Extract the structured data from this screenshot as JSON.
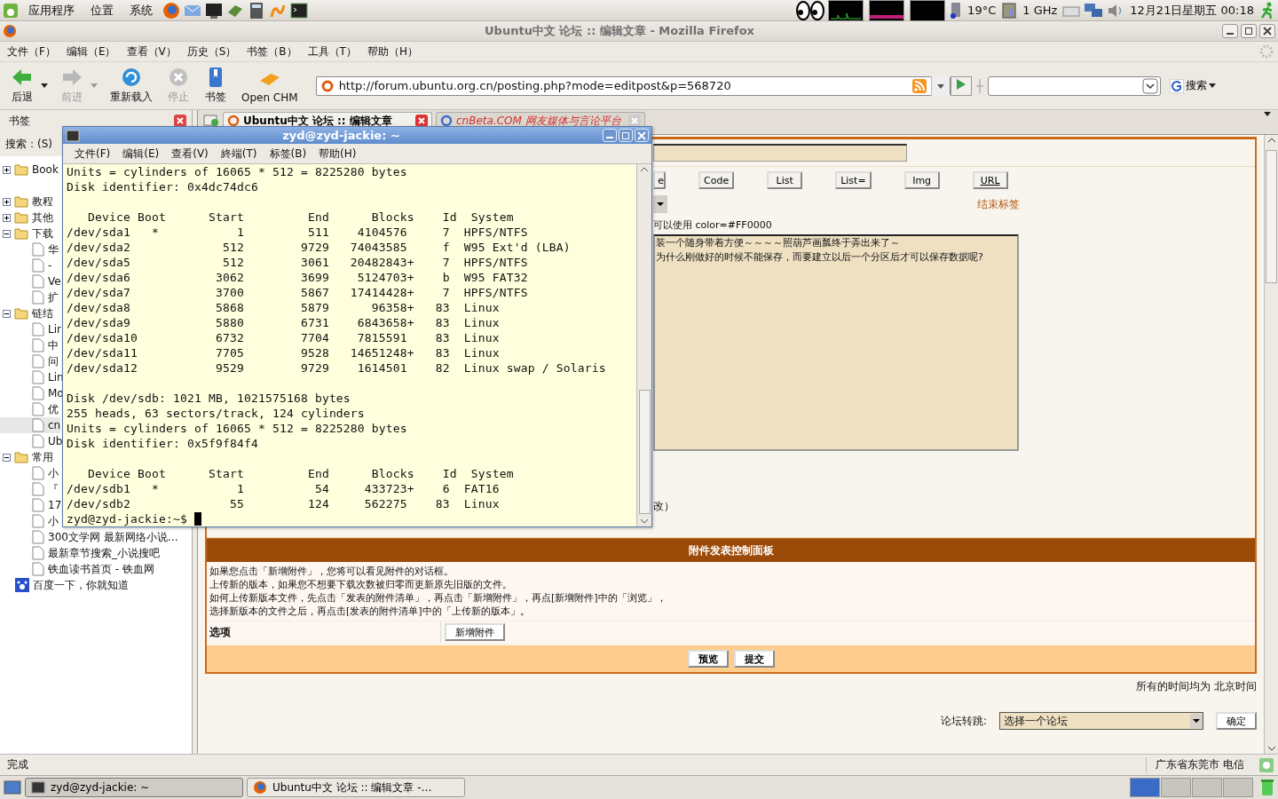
{
  "top_panel": {
    "menus": [
      "应用程序",
      "位置",
      "系统"
    ],
    "temperature": "19°C",
    "cpu": "1 GHz",
    "clock": "12月21日星期五 00:18"
  },
  "window": {
    "title": "Ubuntu中文 论坛 :: 编辑文章 - Mozilla Firefox"
  },
  "menu_bar": [
    "文件（F）",
    "编辑（E）",
    "查看（V）",
    "历史（S）",
    "书签（B）",
    "工具（T）",
    "帮助（H）"
  ],
  "toolbar": {
    "buttons": [
      {
        "label": "后退",
        "kind": "back",
        "disabled": false,
        "dropdown": true
      },
      {
        "label": "前进",
        "kind": "forward",
        "disabled": true,
        "dropdown": true
      },
      {
        "label": "重新载入",
        "kind": "reload",
        "disabled": false,
        "dropdown": false
      },
      {
        "label": "停止",
        "kind": "stop",
        "disabled": true,
        "dropdown": false
      },
      {
        "label": "书签",
        "kind": "bookmarks",
        "disabled": false,
        "dropdown": false
      },
      {
        "label": "Open CHM",
        "kind": "chm",
        "disabled": false,
        "dropdown": false
      }
    ],
    "url": "http://forum.ubuntu.org.cn/posting.php?mode=editpost&p=568720",
    "search_button": "搜索"
  },
  "sidebar": {
    "title": "书签",
    "search_label": "搜索：(S)",
    "tree": [
      {
        "label": "Book",
        "kind": "folder",
        "expanded": false
      },
      {
        "label": "教程",
        "kind": "folder",
        "expanded": false
      },
      {
        "label": "其他",
        "kind": "folder",
        "expanded": false
      },
      {
        "label": "下载",
        "kind": "folder",
        "expanded": true,
        "children": [
          {
            "label": "华",
            "selected": false
          },
          {
            "label": "-",
            "selected": false
          },
          {
            "label": "Ve",
            "selected": false
          },
          {
            "label": "扩",
            "selected": false
          }
        ]
      },
      {
        "label": "链结",
        "kind": "folder",
        "expanded": true,
        "children": [
          {
            "label": "Lir",
            "selected": false
          },
          {
            "label": "中",
            "selected": false
          },
          {
            "label": "问",
            "selected": false
          },
          {
            "label": "Lin",
            "selected": false
          },
          {
            "label": "Mo",
            "selected": false
          },
          {
            "label": "优",
            "selected": false
          },
          {
            "label": "cn",
            "selected": true
          },
          {
            "label": "Ub",
            "selected": false
          }
        ]
      },
      {
        "label": "常用",
        "kind": "folder",
        "expanded": true,
        "children": [
          {
            "label": "小",
            "selected": false
          },
          {
            "label": "『",
            "selected": false
          },
          {
            "label": "17",
            "selected": false
          },
          {
            "label": "小",
            "selected": false
          },
          {
            "label": "300文学网 最新网络小说…",
            "selected": false
          },
          {
            "label": "最新章节搜索_小说搜吧",
            "selected": false
          },
          {
            "label": "铁血读书首页 - 铁血网",
            "selected": false
          }
        ]
      },
      {
        "label": "百度一下，你就知道",
        "kind": "link"
      }
    ]
  },
  "tabs": [
    {
      "label": "Ubuntu中文 论坛 :: 编辑文章",
      "selected": true
    },
    {
      "label": "cnBeta.COM 网友媒体与言论平台",
      "selected": false
    }
  ],
  "editor": {
    "format_buttons": [
      "e",
      "Code",
      "List",
      "List=",
      "Img",
      "URL"
    ],
    "close_tags": "结束标签",
    "hint": "可以使用  color=#FF0000",
    "message_lines": [
      "装一个随身带着方便～～～～照葫芦画瓢终于弄出来了～",
      "为什么刚做好的时候不能保存，而要建立以后一个分区后才可以保存数据呢?"
    ],
    "note": "改）"
  },
  "attachments": {
    "title": "附件发表控制面板",
    "help": [
      "如果您点击「新增附件」，您将可以看见附件的对话框。",
      "上传新的版本，如果您不想要下载次数被归零而更新原先旧版的文件。",
      "如何上传新版本文件，先点击「发表的附件清单」，再点击「新增附件」，再点[新增附件]中的「浏览」，",
      "选择新版本的文件之后，再点击[发表的附件清单]中的「上传新的版本」。"
    ],
    "option_label": "选项",
    "add_button": "新增附件",
    "actions": [
      "预览",
      "提交"
    ]
  },
  "footer": {
    "timezone": "所有的时间均为 北京时间",
    "jump_label": "论坛转跳:",
    "jump_select": "选择一个论坛",
    "jump_button": "确定"
  },
  "terminal": {
    "title": "zyd@zyd-jackie: ~",
    "menus": [
      "文件(F)",
      "编辑(E)",
      "查看(V)",
      "終端(T)",
      "标签(B)",
      "帮助(H)"
    ],
    "blocks": [
      [
        "Units = cylinders of 16065 * 512 = 8225280 bytes",
        "Disk identifier: 0x4dc74dc6"
      ],
      [
        "   Device Boot      Start         End      Blocks    Id  System",
        "/dev/sda1   *           1         511    4104576     7  HPFS/NTFS",
        "/dev/sda2             512        9729   74043585     f  W95 Ext'd (LBA)",
        "/dev/sda5             512        3061   20482843+    7  HPFS/NTFS",
        "/dev/sda6            3062        3699    5124703+    b  W95 FAT32",
        "/dev/sda7            3700        5867   17414428+    7  HPFS/NTFS",
        "/dev/sda8            5868        5879      96358+   83  Linux",
        "/dev/sda9            5880        6731    6843658+   83  Linux",
        "/dev/sda10           6732        7704    7815591    83  Linux",
        "/dev/sda11           7705        9528   14651248+   83  Linux",
        "/dev/sda12           9529        9729    1614501    82  Linux swap / Solaris"
      ],
      [
        "Disk /dev/sdb: 1021 MB, 1021575168 bytes",
        "255 heads, 63 sectors/track, 124 cylinders",
        "Units = cylinders of 16065 * 512 = 8225280 bytes",
        "Disk identifier: 0x5f9f84f4"
      ],
      [
        "   Device Boot      Start         End      Blocks    Id  System",
        "/dev/sdb1   *           1          54     433723+    6  FAT16",
        "/dev/sdb2              55         124     562275    83  Linux"
      ]
    ],
    "prompt": "zyd@zyd-jackie:~$"
  },
  "status_bar": {
    "text": "完成",
    "location": "广东省东莞市 电信"
  },
  "taskbar": {
    "tasks": [
      {
        "label": "zyd@zyd-jackie: ~",
        "kind": "terminal",
        "selected": true
      },
      {
        "label": "Ubuntu中文 论坛 :: 编辑文章 -…",
        "kind": "browser",
        "selected": false
      }
    ]
  }
}
